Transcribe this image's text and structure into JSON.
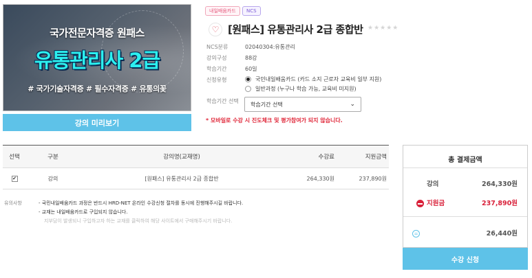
{
  "banner": {
    "line1": "국가전문자격증 원패스",
    "line2": "유통관리사 2급",
    "line3": "# 국가기술자격증 # 필수자격증 # 유통의꽃"
  },
  "preview_button": "강의 미리보기",
  "tags": [
    "내일배움카드",
    "NCS"
  ],
  "course": {
    "title": "[원패스] 유통관리사 2급 종합반",
    "stars": "★★★★★",
    "info": {
      "ncs_label": "NCS분류",
      "ncs_value": "02040304:유통관리",
      "compose_label": "강의구성",
      "compose_value": "88강",
      "period_label": "학습기간",
      "period_value": "60일",
      "apply_type_label": "신청유형",
      "apply_options": [
        "국민내일배움카드 (카드 소지 근로자 교육비 일부 지원)",
        "일반과정 (누구나 학습 가능, 교육비 미지원)"
      ],
      "period_select_label": "학습기간 선택",
      "period_select_value": "학습기간 선택"
    },
    "warning": "* 모바일로 수강 시 진도체크 및 평가참여가 되지 않습니다."
  },
  "table": {
    "headers": [
      "선택",
      "구분",
      "강의명(교재명)",
      "수강료",
      "지원금액"
    ],
    "rows": [
      {
        "type": "강의",
        "name": "[원패스] 유통관리사 2급 종합반",
        "fee": "264,330원",
        "support": "237,890원"
      }
    ]
  },
  "notes": {
    "label": "유의사항",
    "lines": [
      "- 국민내일배움카드 과정은 반드시 HRD-NET 온라인 수강신청 절차를 동시에 진행해주시길 바랍니다.",
      "- 교재는 내일배움카드로 구입되지 않습니다.",
      "지부담이 발생되니 구입하고자 하는 교재를 클릭하여 해당 사이트에서 구매해주시기 바랍니다."
    ]
  },
  "summary": {
    "title": "총 결제금액",
    "lecture_label": "강의",
    "lecture_value": "264,330원",
    "support_label": "지원금",
    "support_value": "237,890원",
    "total_value": "26,440원"
  },
  "apply_button": "수강 신청",
  "colors": {
    "accent": "#5ec2e8",
    "warning": "#e0283a",
    "support": "#d9213a"
  }
}
